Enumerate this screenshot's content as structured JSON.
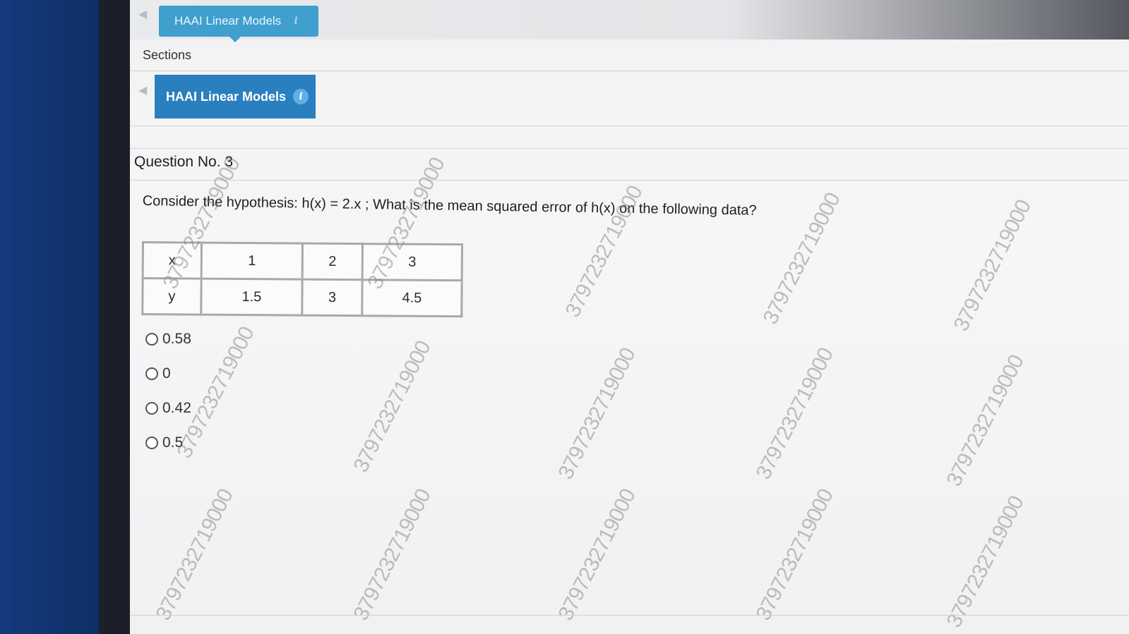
{
  "header": {
    "top_tab_label": "HAAI Linear Models"
  },
  "sidebar": {
    "sections_label": "Sections",
    "section_tab_label": "HAAI Linear Models"
  },
  "question": {
    "number_label": "Question No. 3",
    "text": "Consider the hypothesis: h(x) = 2.x ; What is the mean squared error of h(x) on the following data?",
    "table": {
      "rows": [
        {
          "header": "x",
          "values": [
            "1",
            "2",
            "3"
          ]
        },
        {
          "header": "y",
          "values": [
            "1.5",
            "3",
            "4.5"
          ]
        }
      ]
    },
    "options": [
      "0.58",
      "0",
      "0.42",
      "0.5"
    ]
  },
  "watermark": {
    "text": "3797232719000"
  },
  "icons": {
    "info": "info-icon",
    "back": "back-arrow-icon",
    "radio": "radio-button"
  }
}
